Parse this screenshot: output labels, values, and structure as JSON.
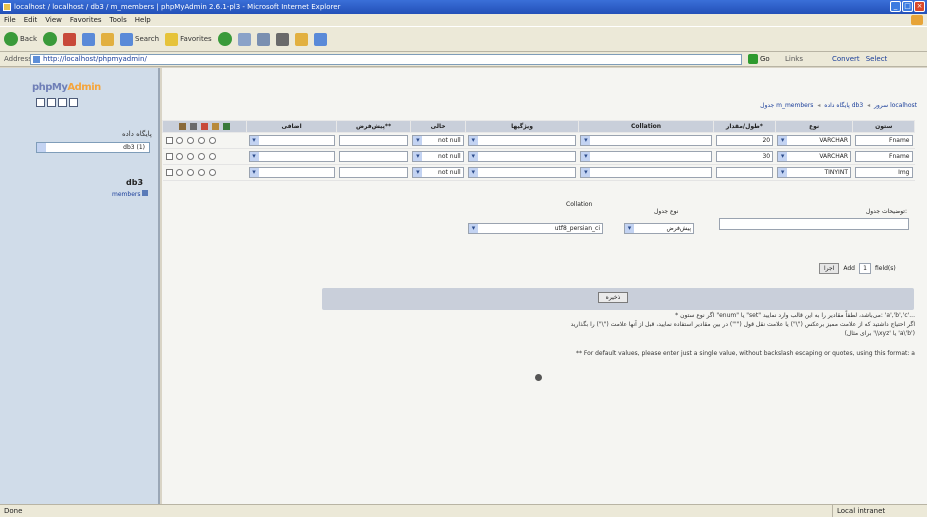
{
  "window": {
    "title": "localhost / localhost / db3 / m_members | phpMyAdmin 2.6.1-pl3 - Microsoft Internet Explorer"
  },
  "menu": [
    "File",
    "Edit",
    "View",
    "Favorites",
    "Tools",
    "Help"
  ],
  "toolbar": {
    "back": "Back",
    "search": "Search",
    "favorites": "Favorites"
  },
  "address": {
    "label": "Address",
    "url": "http://localhost/phpmyadmin/",
    "go": "Go",
    "links": "Links",
    "right_items": [
      "Convert",
      "Select"
    ]
  },
  "left": {
    "logo_main": "phpMy",
    "logo_admin": "Admin",
    "db_label": "پایگاه داده",
    "db_select": "db3 (1)",
    "db_name": "db3",
    "table_item": "members"
  },
  "main": {
    "breadcrumb": [
      "سرور localhost",
      "پایگاه داده db3",
      "جدول m_members"
    ],
    "columns": [
      "ستون",
      "نوع",
      "طول/مقدار*",
      "Collation",
      "ویژگیها",
      "خالی",
      "پیش‌فرض**",
      "اضافی"
    ],
    "rows": [
      {
        "name": "Fname",
        "type": "VARCHAR",
        "length": "20",
        "collation": "",
        "attributes": "",
        "null": "not null",
        "default": "",
        "extra": ""
      },
      {
        "name": "Fname",
        "type": "VARCHAR",
        "length": "30",
        "collation": "",
        "attributes": "",
        "null": "not null",
        "default": "",
        "extra": ""
      },
      {
        "name": "Img",
        "type": "TINYINT",
        "length": "",
        "collation": "",
        "attributes": "",
        "null": "not null",
        "default": "",
        "extra": ""
      }
    ],
    "table_comment_label": "توضیحات جدول:",
    "table_type_label": "نوع جدول",
    "table_type_value": "پیش‌فرض",
    "collation_label": "Collation",
    "collation_value": "utf8_persian_ci",
    "add_prefix": "Add",
    "add_count": "1",
    "add_suffix": "field(s)",
    "go_label": "اجرا",
    "save_label": "ذخیره",
    "note1": "* اگر نوع ستون \"enum\" یا \"set\" می‌باشد، لطفاً مقادیر را به این قالب وارد نمایید: 'a','b','c'...",
    "note2": "اگر احتیاج داشتید که از علامت ممیز برعکس (\"\\\") یا علامت نقل قول (\"'\") در بین مقادیر استفاده نمایید، قبل از آنها علامت (\"\\\") را بگذارید",
    "note3": "(برای مثال '\\\\xyz' یا 'a\\'b')",
    "note4": "** For default values, please enter just a single value, without backslash escaping or quotes, using this format: a"
  },
  "status": {
    "left": "Done",
    "zone": "Local intranet"
  }
}
